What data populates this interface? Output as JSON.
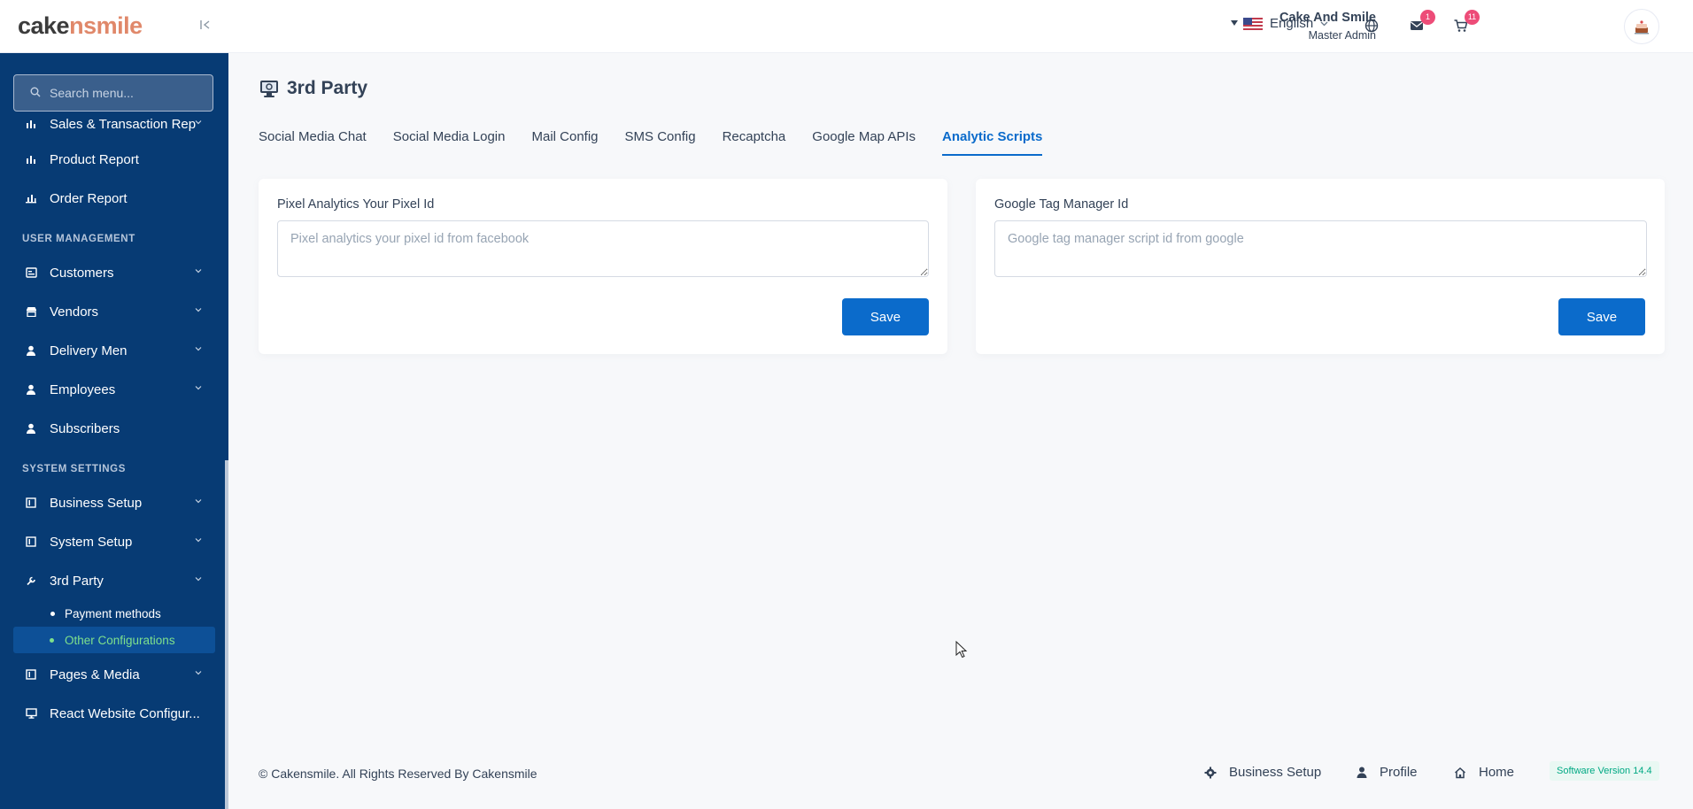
{
  "brand": {
    "logo_part1": "cake",
    "logo_part2": "nsmile"
  },
  "sidebar": {
    "search_placeholder": "Search menu...",
    "items": [
      {
        "label": "Sales & Transaction Rep",
        "icon": "bar-chart-icon",
        "chevron": true
      },
      {
        "label": "Product Report",
        "icon": "bar-chart-icon",
        "chevron": false
      },
      {
        "label": "Order Report",
        "icon": "bar-chart-icon",
        "chevron": false
      }
    ],
    "section_user": "USER MANAGEMENT",
    "user_items": [
      {
        "label": "Customers",
        "icon": "customers-icon"
      },
      {
        "label": "Vendors",
        "icon": "vendors-icon"
      },
      {
        "label": "Delivery Men",
        "icon": "user-icon"
      },
      {
        "label": "Employees",
        "icon": "user-icon"
      },
      {
        "label": "Subscribers",
        "icon": "user-icon"
      }
    ],
    "section_system": "SYSTEM SETTINGS",
    "system_items": [
      {
        "label": "Business Setup",
        "icon": "page-icon"
      },
      {
        "label": "System Setup",
        "icon": "page-icon"
      },
      {
        "label": "3rd Party",
        "icon": "wrench-icon"
      }
    ],
    "sub_items": [
      {
        "label": "Payment methods",
        "active": false
      },
      {
        "label": "Other Configurations",
        "active": true
      }
    ],
    "bottom_items": [
      {
        "label": "Pages & Media",
        "icon": "page-icon"
      },
      {
        "label": "React Website Configur...",
        "icon": "monitor-icon"
      }
    ]
  },
  "header": {
    "language": "English",
    "mail_badge": "1",
    "cart_badge": "11",
    "user_name": "Cake And Smile",
    "user_role": "Master Admin"
  },
  "page": {
    "title": "3rd Party",
    "tabs": [
      {
        "label": "Social Media Chat",
        "active": false
      },
      {
        "label": "Social Media Login",
        "active": false
      },
      {
        "label": "Mail Config",
        "active": false
      },
      {
        "label": "SMS Config",
        "active": false
      },
      {
        "label": "Recaptcha",
        "active": false
      },
      {
        "label": "Google Map APIs",
        "active": false
      },
      {
        "label": "Analytic Scripts",
        "active": true
      }
    ],
    "pixel": {
      "label": "Pixel Analytics Your Pixel Id",
      "placeholder": "Pixel analytics your pixel id from facebook",
      "value": "",
      "save_label": "Save"
    },
    "gtm": {
      "label": "Google Tag Manager Id",
      "placeholder": "Google tag manager script id from google",
      "value": "",
      "save_label": "Save"
    }
  },
  "footer": {
    "copyright": "© Cakensmile. All Rights Reserved By Cakensmile",
    "links": [
      "Business Setup",
      "Profile",
      "Home"
    ],
    "version": "Software Version 14.4"
  },
  "colors": {
    "sidebar": "#073b74",
    "primary": "#0b6bcb",
    "active_sub": "#7ee08c",
    "badge": "#ed4c78"
  }
}
